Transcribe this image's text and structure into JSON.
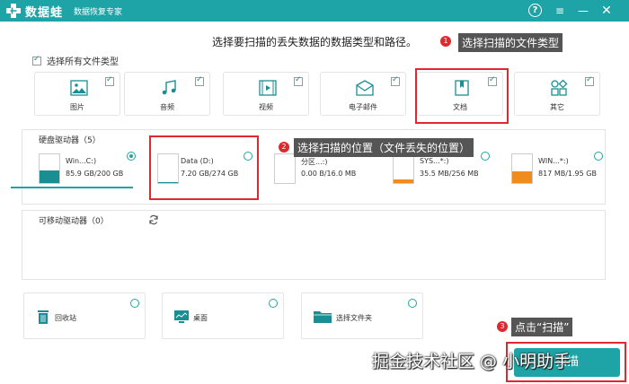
{
  "titlebar": {
    "app_name": "数据蛙",
    "slogan": "数据恢复专家",
    "help": "?",
    "menu": "≡",
    "minimize": "—",
    "close": "✕"
  },
  "instruction": "选择要扫描的丢失数据的数据类型和路径。",
  "select_all_label": "选择所有文件类型",
  "file_types": [
    {
      "label": "图片",
      "icon": "image-icon",
      "checked": true
    },
    {
      "label": "音频",
      "icon": "music-icon",
      "checked": true
    },
    {
      "label": "视频",
      "icon": "video-icon",
      "checked": true
    },
    {
      "label": "电子邮件",
      "icon": "email-icon",
      "checked": true
    },
    {
      "label": "文档",
      "icon": "document-icon",
      "checked": true
    },
    {
      "label": "其它",
      "icon": "other-icon",
      "checked": true
    }
  ],
  "callouts": {
    "c1_num": "1",
    "c1_text": "选择扫描的文件类型",
    "c2_num": "2",
    "c2_text": "选择扫描的位置（文件丢失的位置）",
    "c3_num": "3",
    "c3_text": "点击“扫描”"
  },
  "hard_drives": {
    "title": "硬盘驱动器（5）",
    "items": [
      {
        "name": "Win...C:)",
        "size": "85.9 GB/200 GB",
        "fill": 0.43,
        "color": "#1a8f93",
        "selected": true
      },
      {
        "name": "Data (D:)",
        "size": "7.20 GB/274 GB",
        "fill": 0.03,
        "color": "#1a8f93",
        "selected": false
      },
      {
        "name": "分区...:)",
        "size": "0.00  B/16.0 MB",
        "fill": 0.0,
        "color": "#f08c1e",
        "selected": false
      },
      {
        "name": "SYS...*:)",
        "size": "35.5 MB/256 MB",
        "fill": 0.14,
        "color": "#f08c1e",
        "selected": false
      },
      {
        "name": "WIN...*:)",
        "size": "817 MB/1.95 GB",
        "fill": 0.42,
        "color": "#f08c1e",
        "selected": false
      }
    ]
  },
  "removable": {
    "title": "可移动驱动器（0）"
  },
  "locations": [
    {
      "label": "回收站",
      "icon": "recycle-bin-icon"
    },
    {
      "label": "桌面",
      "icon": "desktop-icon"
    },
    {
      "label": "选择文件夹",
      "icon": "folder-icon"
    }
  ],
  "scan_button": "扫描",
  "watermark": "掘金技术社区 @ 小明助手",
  "colors": {
    "accent": "#1ea3a6",
    "highlight": "#e0282e",
    "warning": "#f08c1e"
  }
}
